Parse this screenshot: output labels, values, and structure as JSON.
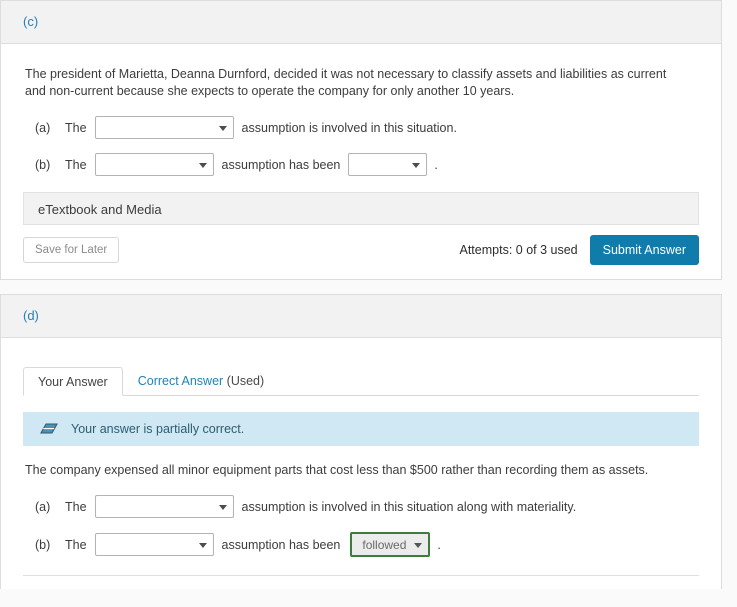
{
  "sections": [
    {
      "label": "(c)",
      "prompt": "The president of Marietta, Deanna Durnford, decided it was not necessary to classify assets and liabilities as current and non-current because she expects to operate the company for only another 10 years.",
      "statements": [
        {
          "letter": "(a)",
          "the": "The",
          "assumption_value": "",
          "assumption_placeholder": "",
          "tail": "assumption is involved in this situation.",
          "status_value": null,
          "period": ""
        },
        {
          "letter": "(b)",
          "the": "The",
          "assumption_value": "",
          "assumption_placeholder": "",
          "tail": "assumption has been",
          "status_value": "",
          "period": "."
        }
      ],
      "etextbook_label": "eTextbook and Media",
      "save_label": "Save for Later",
      "attempts_label": "Attempts: 0 of 3 used",
      "submit_label": "Submit Answer"
    },
    {
      "label": "(d)",
      "tabs": [
        {
          "label": "Your Answer",
          "suffix": "",
          "active": true
        },
        {
          "label": "Correct Answer",
          "suffix": " (Used)",
          "active": false
        }
      ],
      "alert": {
        "icon": "eraser-icon",
        "text": "Your answer is partially correct."
      },
      "prompt": "The company expensed all minor equipment parts that cost less than $500 rather than recording them as assets.",
      "statements": [
        {
          "letter": "(a)",
          "the": "The",
          "assumption_value": "",
          "assumption_placeholder": "",
          "tail": "assumption is involved in this situation along with materiality.",
          "status_value": null,
          "period": ""
        },
        {
          "letter": "(b)",
          "the": "The",
          "assumption_value": "",
          "assumption_placeholder": "",
          "tail": "assumption has been",
          "status_value": "followed",
          "period": "."
        }
      ]
    }
  ],
  "colors": {
    "accent_blue": "#2380b8",
    "submit_blue": "#0f7cab",
    "alert_bg": "#cfe8f3",
    "graded_green": "#3c7d3c",
    "header_bg": "#f2f2f2"
  }
}
